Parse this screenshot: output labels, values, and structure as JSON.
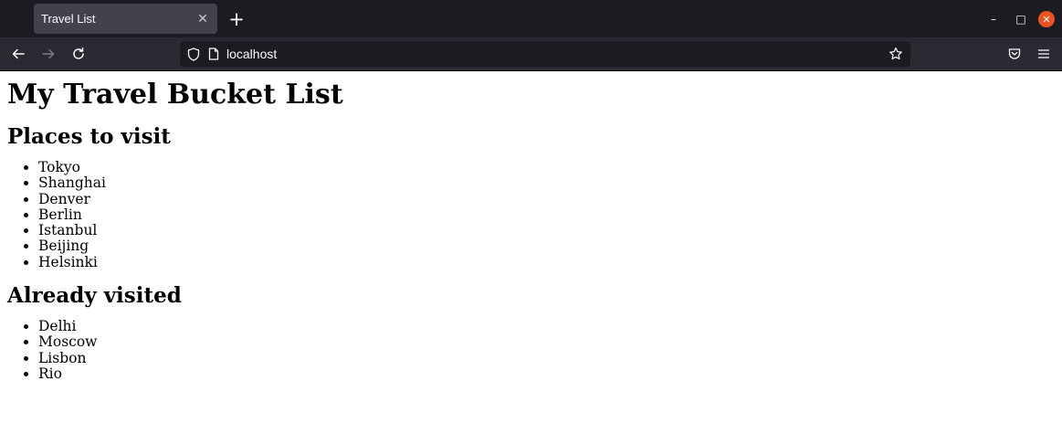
{
  "browser": {
    "tab_title": "Travel List",
    "tab_close_glyph": "✕",
    "new_tab_glyph": "+",
    "url": "localhost",
    "minimize_glyph": "–",
    "maximize_glyph": "□",
    "close_glyph": "✕"
  },
  "page": {
    "title": "My Travel Bucket List",
    "sections": [
      {
        "heading": "Places to visit",
        "items": [
          "Tokyo",
          "Shanghai",
          "Denver",
          "Berlin",
          "Istanbul",
          "Beijing",
          "Helsinki"
        ]
      },
      {
        "heading": "Already visited",
        "items": [
          "Delhi",
          "Moscow",
          "Lisbon",
          "Rio"
        ]
      }
    ]
  }
}
